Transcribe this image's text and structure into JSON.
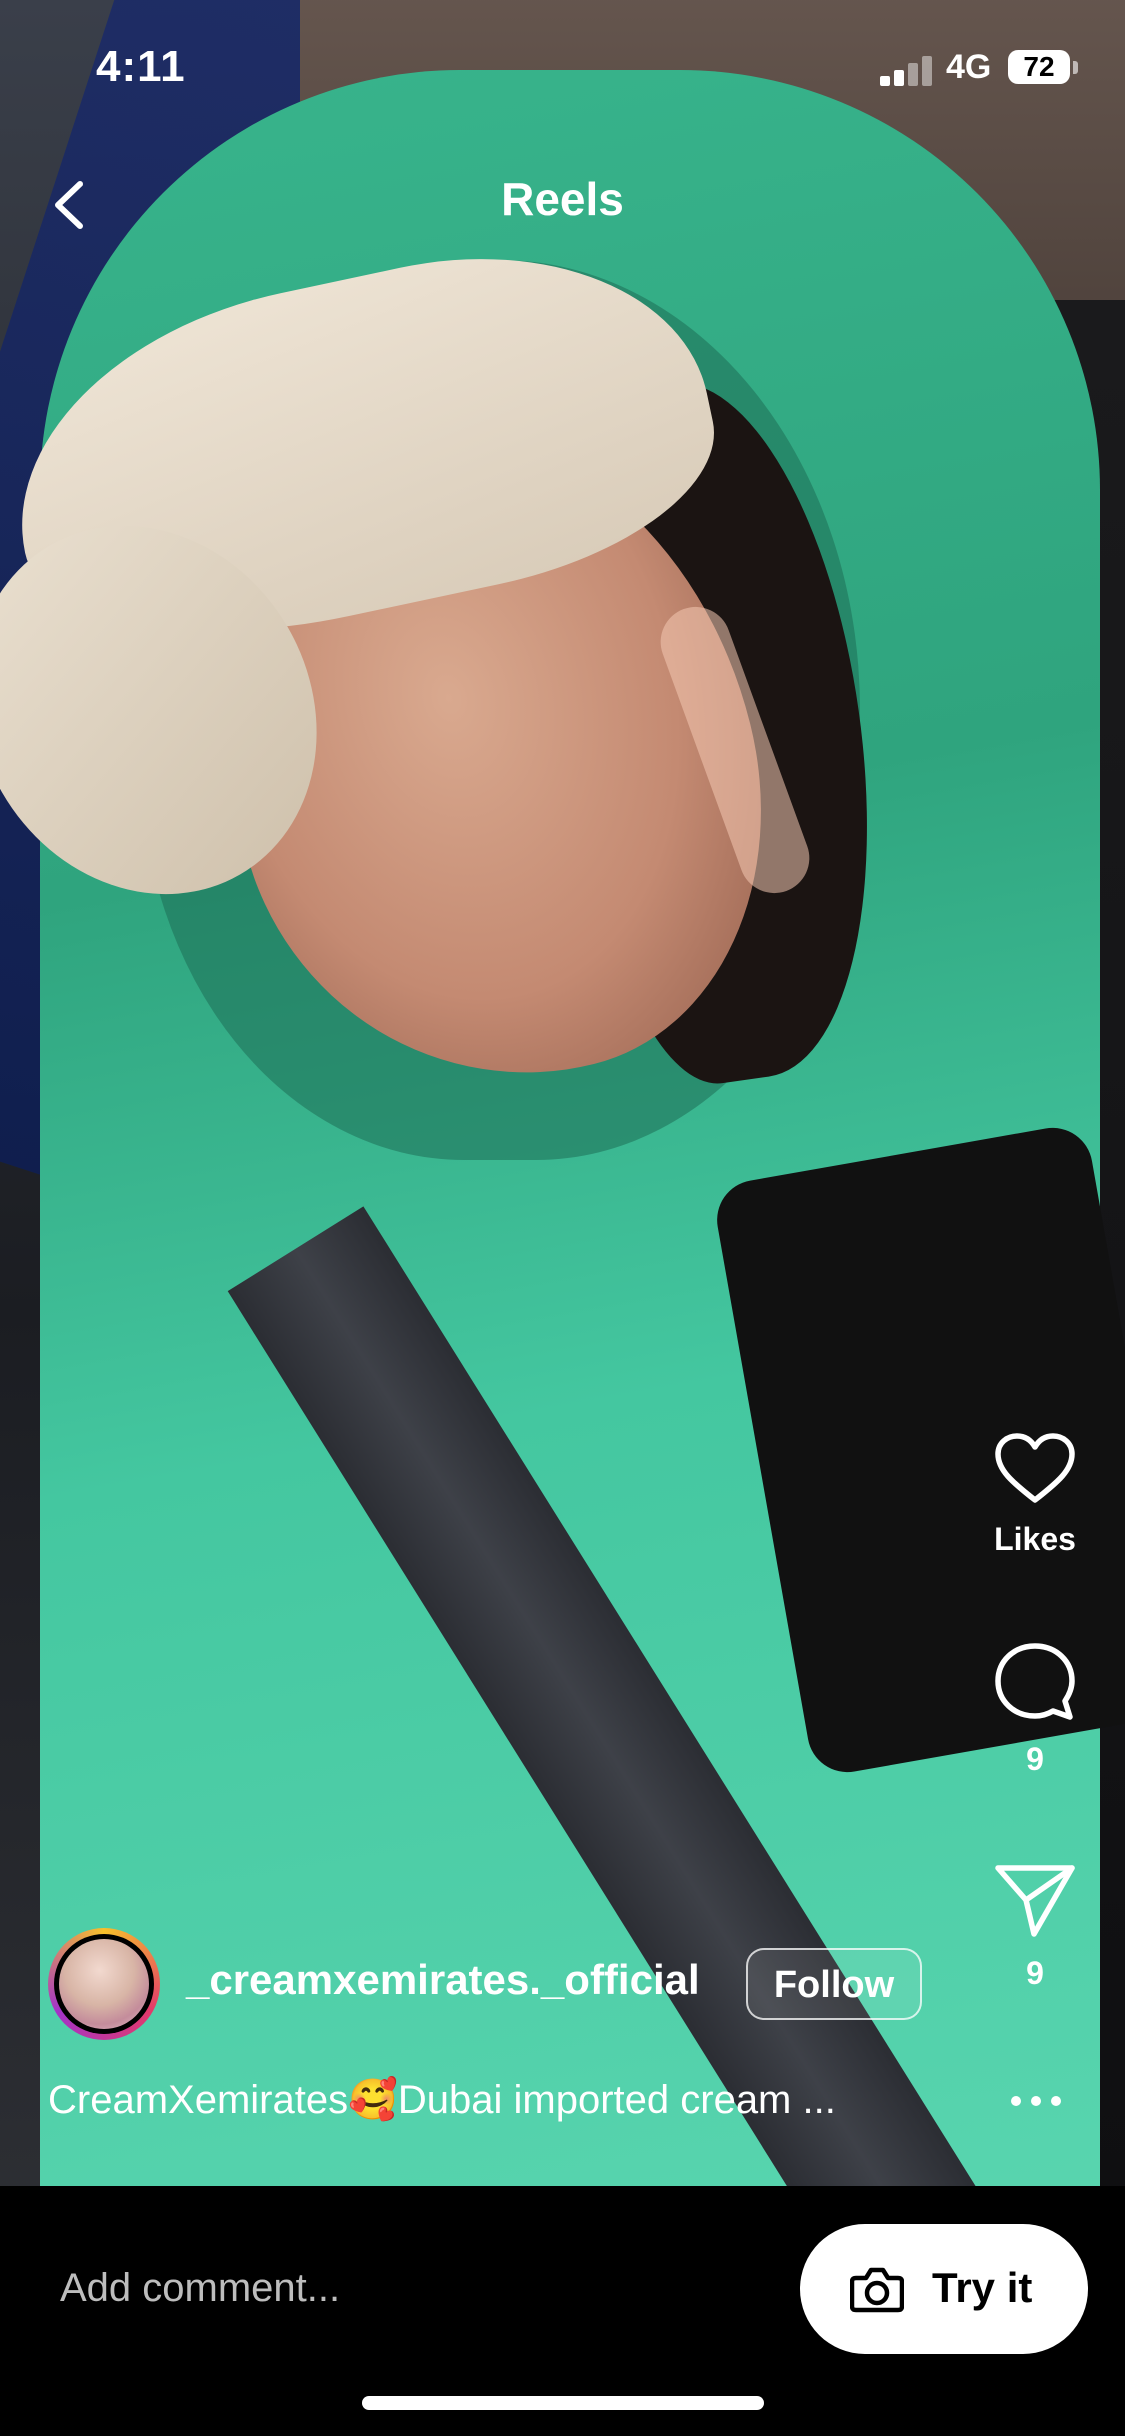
{
  "status_bar": {
    "time": "4:11",
    "network": "4G",
    "battery": "72"
  },
  "header": {
    "title": "Reels"
  },
  "actions": {
    "likes_label": "Likes",
    "comments_count": "9",
    "shares_count": "9"
  },
  "author": {
    "username": "_creamxemirates._official",
    "follow_label": "Follow"
  },
  "caption": "CreamXemirates🥰Dubai imported cream ...",
  "bottom_bar": {
    "comment_placeholder": "Add comment...",
    "try_it_label": "Try it"
  }
}
